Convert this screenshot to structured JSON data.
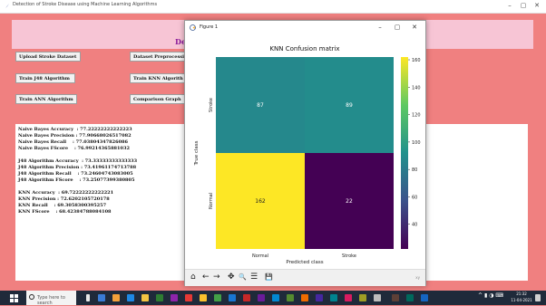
{
  "window": {
    "title": "Detection of Stroke Disease using Machine Learning Algorithms",
    "min": "–",
    "max": "▢",
    "close": "✕"
  },
  "heading": {
    "text": "De"
  },
  "buttons": {
    "upload": "Upload Stroke Dataset",
    "preprocess": "Dataset Preprocessi",
    "train_j48": "Train J48 Algorithm",
    "train_knn": "Train KNN Algorith",
    "train_ann": "Train ANN Algorithm",
    "comparison": "Comparison Graph"
  },
  "results": {
    "lines": [
      "Naive Bayes Accuracy  : 77.22222222222223",
      "Naive Bayes Precision : 77.90668026517082",
      "Naive Bayes Recall    : 77.03804347826086",
      "Naive Bayes FScore    : 76.99214365881032",
      "",
      "J48 Algorithm Accuracy  : 73.33333333333333",
      "J48 Algorithm Precision : 73.41961174713788",
      "J48 Algorithm Recall    : 73.24604743083005",
      "J48 Algorithm FScore    : 73.25077399380805",
      "",
      "KNN Accuracy  : 69.72222222222221",
      "KNN Precision : 72.6202105720178",
      "KNN Recall    : 69.3058300395257",
      "KNN FScore    : 68.42384788084108"
    ]
  },
  "figure": {
    "title": "Figure 1",
    "min": "–",
    "max": "▢",
    "close": "✕",
    "coords": "xy"
  },
  "toolbar": {
    "home": "⌂",
    "back": "←",
    "forward": "→",
    "pan": "✥",
    "zoom": "🔍",
    "configure": "☰",
    "save": "💾"
  },
  "colors": {
    "app_bg": "#f08080",
    "heading_band": "#f7c5d5",
    "heading_text": "#8a1a9a",
    "cell_87": "#21918c",
    "cell_89": "#21918c",
    "cell_162": "#fde725",
    "cell_22": "#440154"
  },
  "chart_data": {
    "type": "heatmap",
    "title": "KNN Confusion matrix",
    "xlabel": "Predicted class",
    "ylabel": "True class",
    "x_categories": [
      "Normal",
      "Stroke"
    ],
    "y_categories": [
      "Stroke",
      "Normal"
    ],
    "values": [
      [
        87,
        89
      ],
      [
        162,
        22
      ]
    ],
    "colorbar": {
      "min": 22,
      "max": 162,
      "ticks": [
        40,
        60,
        80,
        100,
        120,
        140,
        160
      ]
    },
    "colormap": "viridis"
  },
  "taskbar": {
    "search_placeholder": "Type here to search",
    "time": "21:32",
    "date": "11-04-2021"
  }
}
